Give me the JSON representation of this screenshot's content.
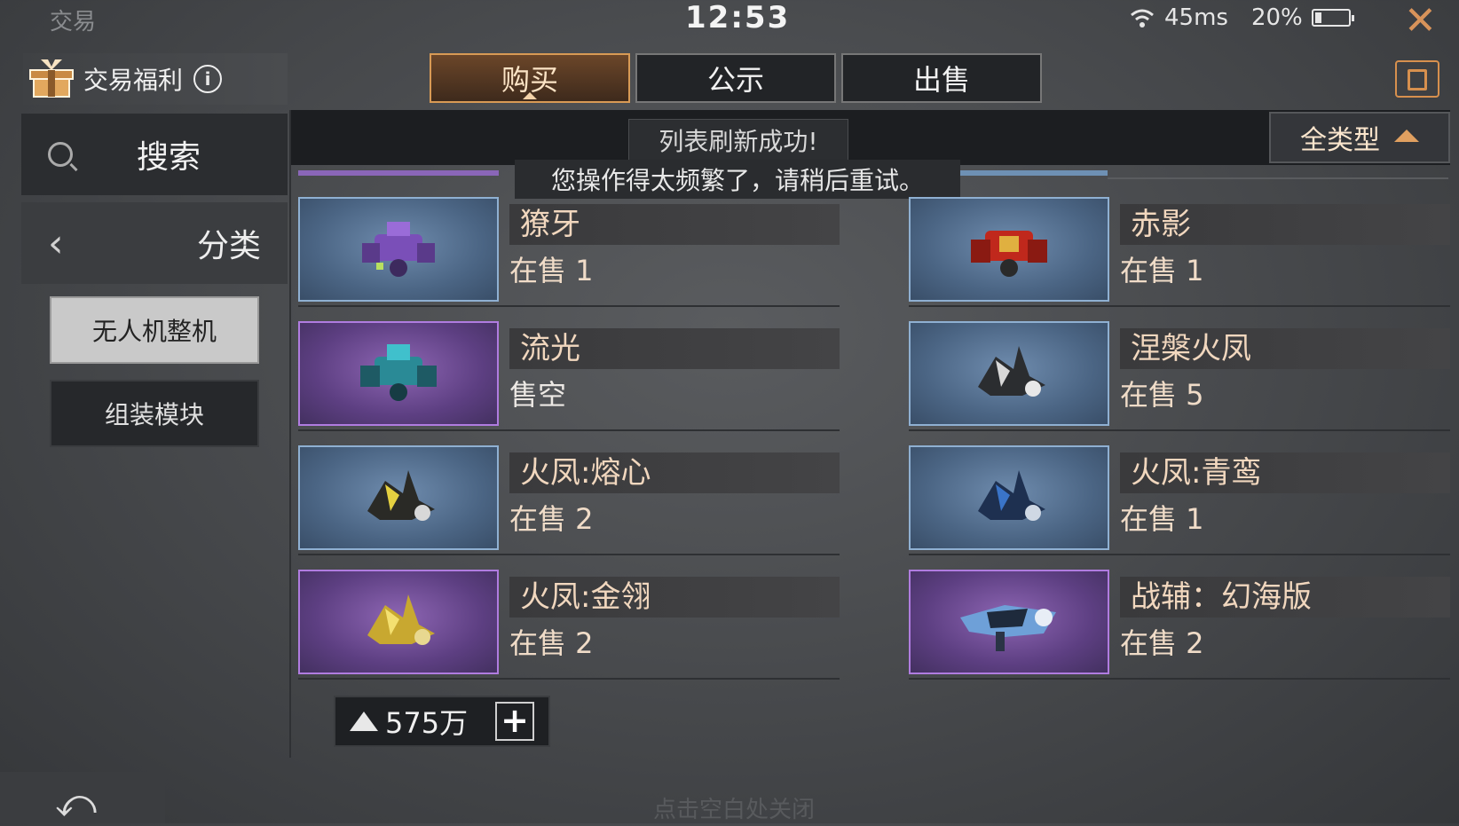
{
  "status_bar": {
    "title": "交易",
    "time": "12:53",
    "ping": "45ms",
    "battery": "20%",
    "battery_level": 0.2
  },
  "benefit": {
    "label": "交易福利",
    "info": "i"
  },
  "tabs": [
    {
      "label": "购买",
      "active": true
    },
    {
      "label": "公示",
      "active": false
    },
    {
      "label": "出售",
      "active": false
    }
  ],
  "sidebar": {
    "search_label": "搜索",
    "category_label": "分类",
    "categories": [
      {
        "label": "无人机整机",
        "selected": true
      },
      {
        "label": "组装模块",
        "selected": false
      }
    ]
  },
  "list": {
    "toast_refresh": "列表刷新成功!",
    "toast_warning": "您操作得太频繁了，请稍后重试。",
    "filter_label": "全类型",
    "items": [
      {
        "name": "獠牙",
        "stock": "在售 1",
        "rarity": "blue"
      },
      {
        "name": "赤影",
        "stock": "在售 1",
        "rarity": "blue"
      },
      {
        "name": "流光",
        "stock": "售空",
        "rarity": "purple"
      },
      {
        "name": "涅槃火凤",
        "stock": "在售 5",
        "rarity": "blue"
      },
      {
        "name": "火凤:熔心",
        "stock": "在售 2",
        "rarity": "blue"
      },
      {
        "name": "火凤:青鸾",
        "stock": "在售 1",
        "rarity": "blue"
      },
      {
        "name": "火凤:金翎",
        "stock": "在售 2",
        "rarity": "purple"
      },
      {
        "name": "战辅：幻海版",
        "stock": "在售 2",
        "rarity": "purple"
      }
    ]
  },
  "currency": {
    "amount": "575万",
    "add": "+"
  },
  "footer": {
    "hint": "点击空白处关闭",
    "undo": "⤺"
  },
  "colors": {
    "accent": "#d89a55",
    "blue_rarity": "#8fb0d2",
    "purple_rarity": "#b07ce0"
  }
}
